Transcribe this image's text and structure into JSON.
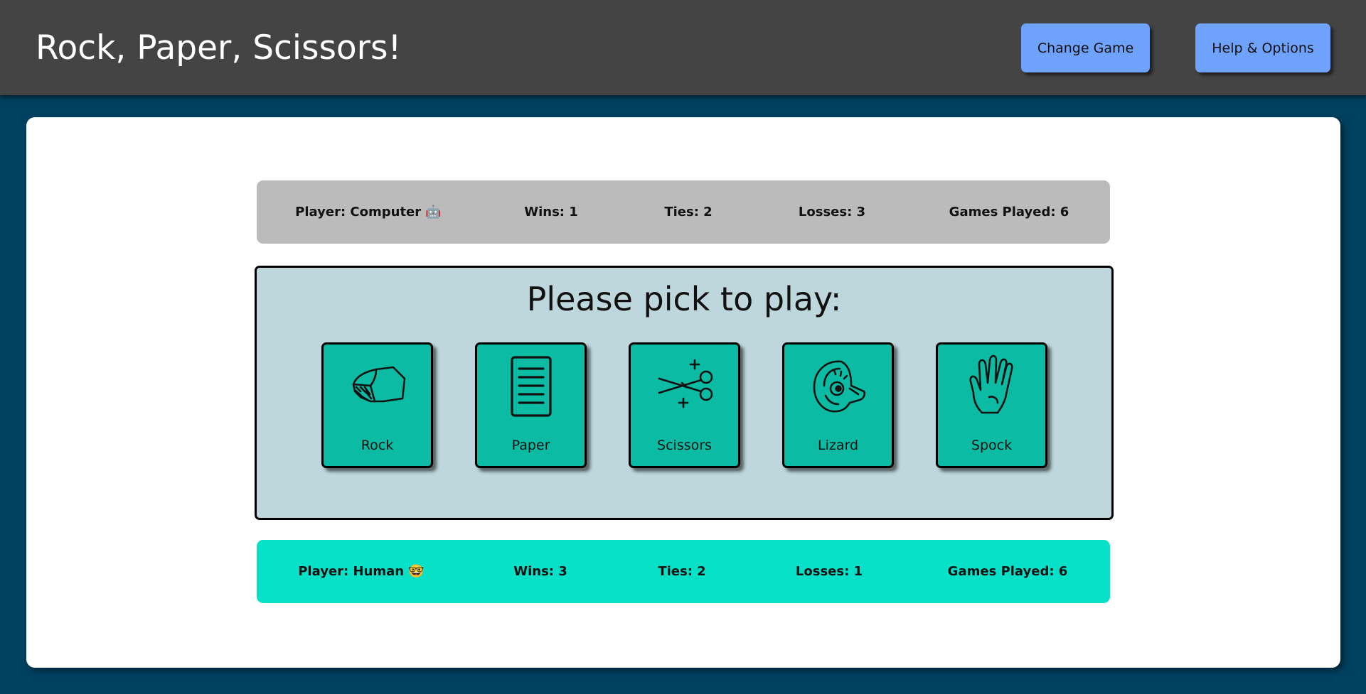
{
  "header": {
    "title": "Rock, Paper, Scissors!",
    "change_game_label": "Change Game",
    "help_label": "Help & Options"
  },
  "computer": {
    "player": "Player: Computer 🤖",
    "wins": "Wins: 1",
    "ties": "Ties: 2",
    "losses": "Losses: 3",
    "games_played": "Games Played: 6"
  },
  "human": {
    "player": "Player: Human 🤓",
    "wins": "Wins: 3",
    "ties": "Ties: 2",
    "losses": "Losses: 1",
    "games_played": "Games Played: 6"
  },
  "pick": {
    "title": "Please pick to play:",
    "choices": [
      {
        "label": "Rock",
        "icon": "rock-icon"
      },
      {
        "label": "Paper",
        "icon": "paper-icon"
      },
      {
        "label": "Scissors",
        "icon": "scissors-icon"
      },
      {
        "label": "Lizard",
        "icon": "lizard-icon"
      },
      {
        "label": "Spock",
        "icon": "spock-icon"
      }
    ]
  },
  "colors": {
    "header_bg": "#444444",
    "page_bg": "#00405f",
    "button_bg": "#6fa2fb",
    "computer_bar": "#bbbbbb",
    "human_bar": "#07e1c7",
    "panel_bg": "#bdd7dd",
    "choice_bg": "#0cbba3"
  }
}
